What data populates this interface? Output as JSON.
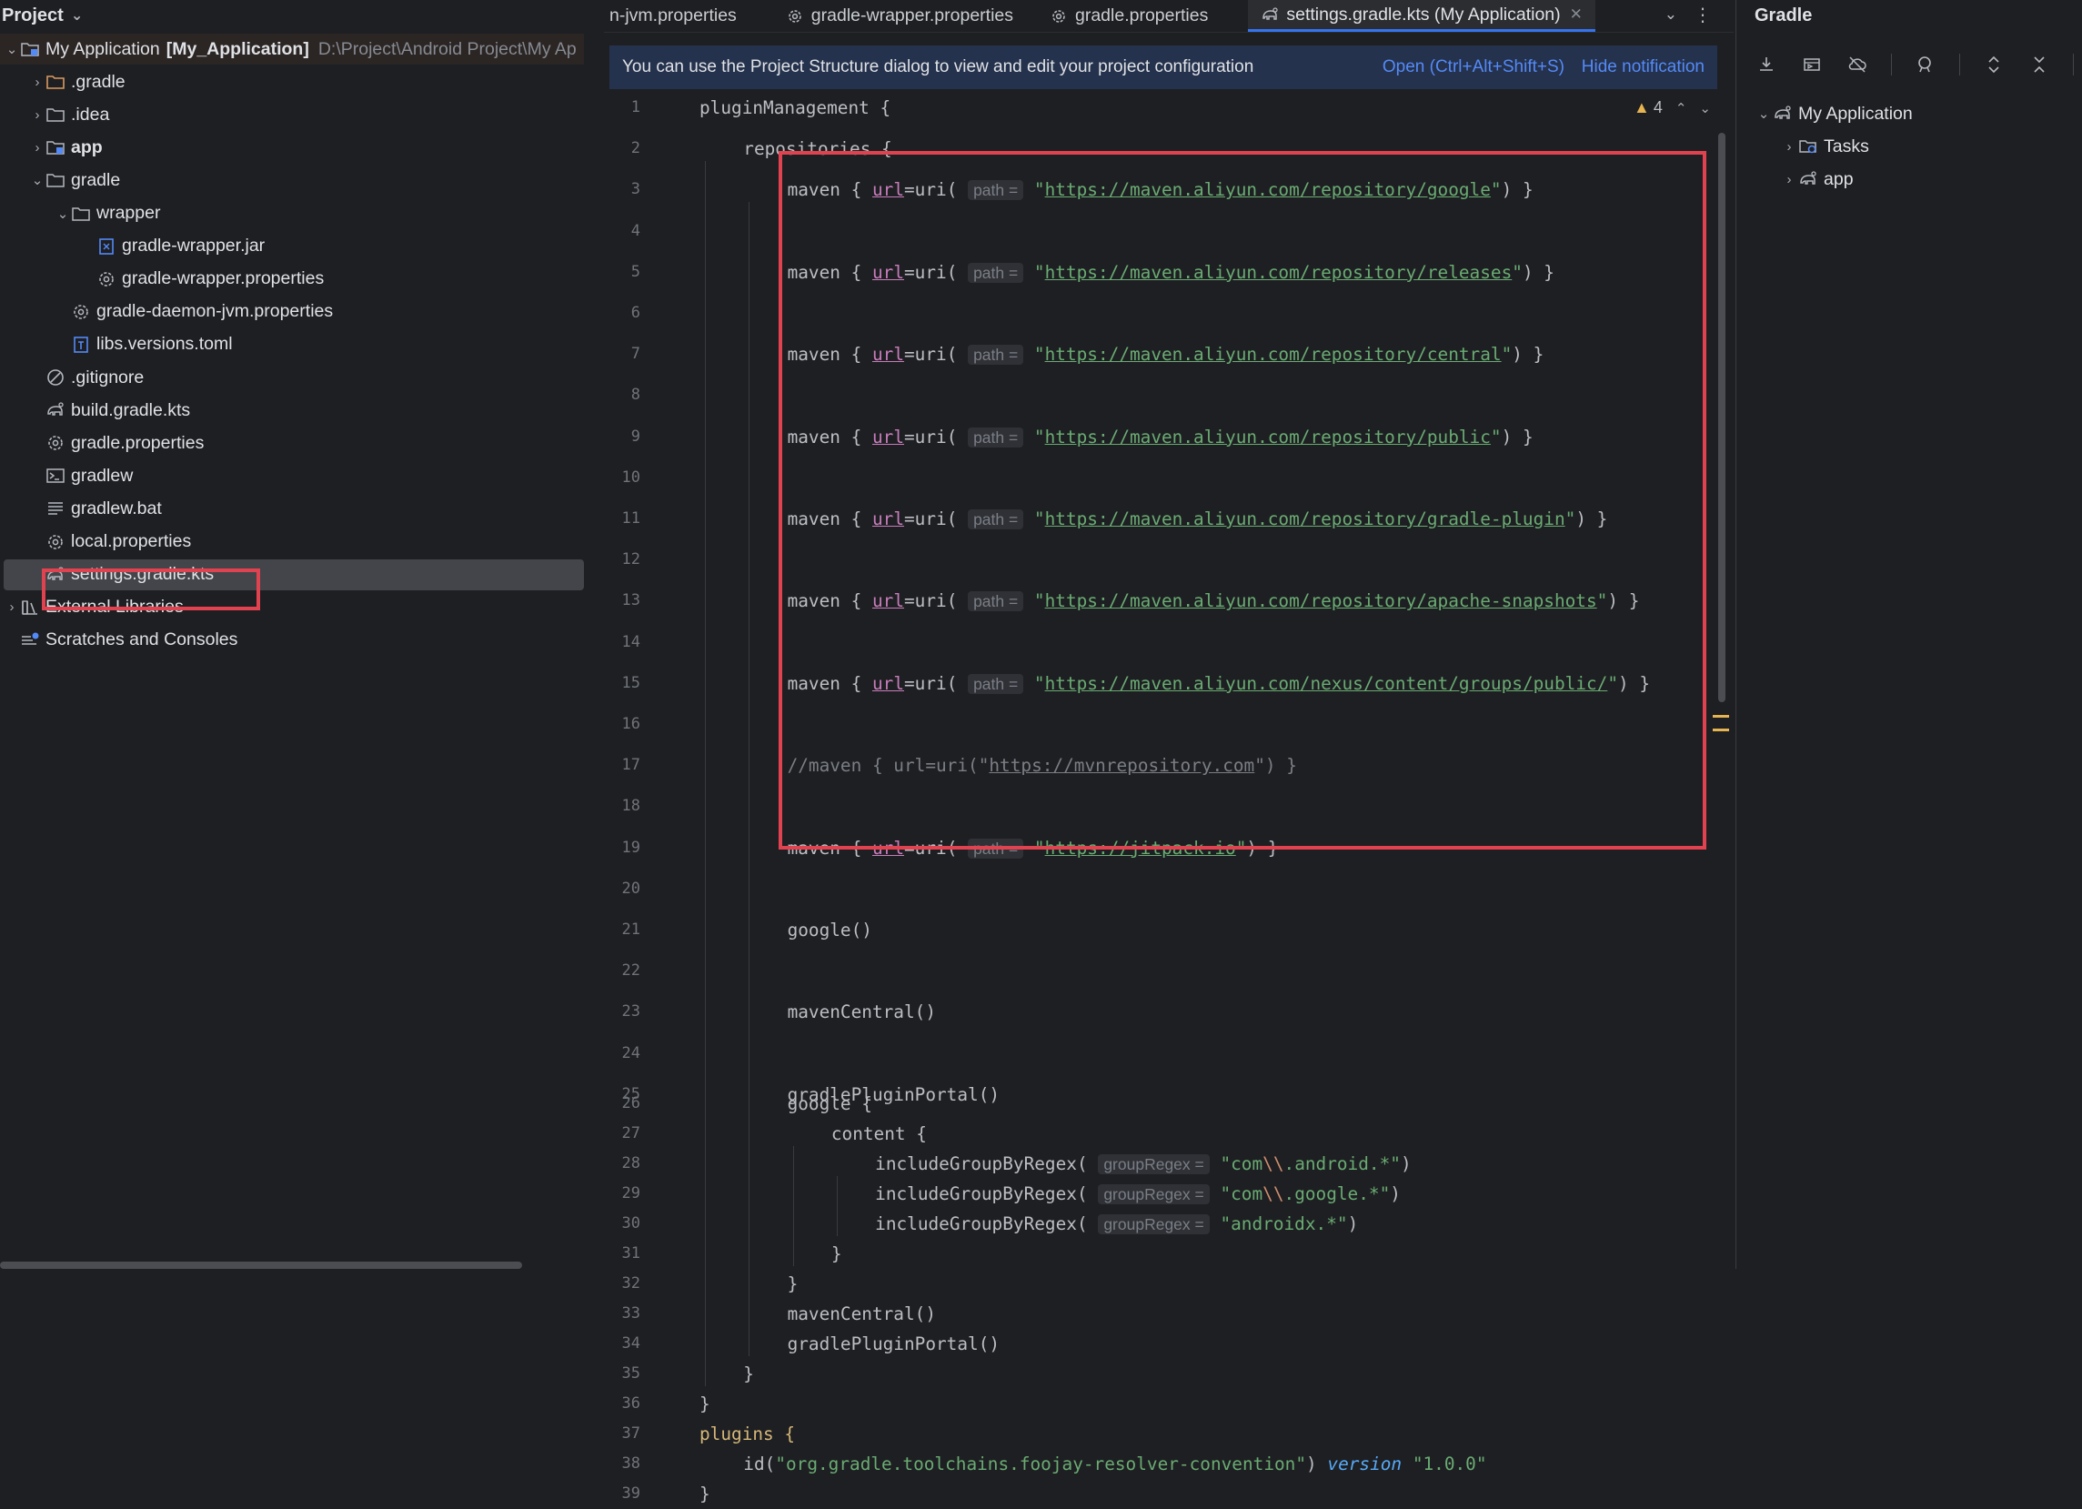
{
  "project_panel": {
    "title": "Project",
    "tree": [
      {
        "label": "My Application",
        "bold_suffix": "[My_Application]",
        "path": "D:\\Project\\Android Project\\My Ap",
        "icon": "module-folder-icon"
      },
      {
        "label": ".gradle",
        "icon": "folder-icon"
      },
      {
        "label": ".idea",
        "icon": "folder-icon"
      },
      {
        "label": "app",
        "icon": "module-folder-icon"
      },
      {
        "label": "gradle",
        "icon": "folder-icon"
      },
      {
        "label": "wrapper",
        "icon": "folder-icon"
      },
      {
        "label": "gradle-wrapper.jar",
        "icon": "jar-icon"
      },
      {
        "label": "gradle-wrapper.properties",
        "icon": "gear-icon"
      },
      {
        "label": "gradle-daemon-jvm.properties",
        "icon": "gear-icon"
      },
      {
        "label": "libs.versions.toml",
        "icon": "toml-icon"
      },
      {
        "label": ".gitignore",
        "icon": "ignore-icon"
      },
      {
        "label": "build.gradle.kts",
        "icon": "gradle-elephant-icon"
      },
      {
        "label": "gradle.properties",
        "icon": "gear-icon"
      },
      {
        "label": "gradlew",
        "icon": "terminal-icon"
      },
      {
        "label": "gradlew.bat",
        "icon": "text-lines-icon"
      },
      {
        "label": "local.properties",
        "icon": "gear-icon"
      },
      {
        "label": "settings.gradle.kts",
        "icon": "gradle-elephant-icon"
      },
      {
        "label": "External Libraries",
        "icon": "library-icon"
      },
      {
        "label": "Scratches and Consoles",
        "icon": "scratches-icon"
      }
    ]
  },
  "editor": {
    "tabs": [
      {
        "label": "n-jvm.properties",
        "icon": "gear-icon"
      },
      {
        "label": "gradle-wrapper.properties",
        "icon": "gear-icon"
      },
      {
        "label": "gradle.properties",
        "icon": "gear-icon"
      },
      {
        "label": "settings.gradle.kts (My Application)",
        "icon": "gradle-elephant-icon"
      }
    ],
    "notification": {
      "text": "You can use the Project Structure dialog to view and edit your project configuration",
      "open_link": "Open (Ctrl+Alt+Shift+S)",
      "hide_link": "Hide notification"
    },
    "warnings_count": "4",
    "hints": {
      "path": "path =",
      "group_regex": "groupRegex ="
    },
    "code": {
      "l1": "pluginManagement {",
      "l2": "repositories {",
      "maven_prefix": "maven { ",
      "url_param": "url",
      "uri_call": "=uri(",
      "urls": [
        "https://maven.aliyun.com/repository/google",
        "https://maven.aliyun.com/repository/releases",
        "https://maven.aliyun.com/repository/central",
        "https://maven.aliyun.com/repository/public",
        "https://maven.aliyun.com/repository/gradle-plugin",
        "https://maven.aliyun.com/repository/apache-snapshots",
        "https://maven.aliyun.com/nexus/content/groups/public/",
        "https://jitpack.io"
      ],
      "comment_prefix": "//maven { url=uri(\"",
      "comment_url": "https://mvnrepository.com",
      "comment_suffix": "\") }",
      "l21": "google()",
      "l23": "mavenCentral()",
      "l25": "gradlePluginPortal()",
      "l26": "google {",
      "l27": "content {",
      "include_fn": "includeGroupByRegex(",
      "regex1_a": "com",
      "regex1_b": ".android.*",
      "regex2_a": "com",
      "regex2_b": ".google.*",
      "regex3": "androidx.*",
      "esc": "\\\\",
      "l33": "mavenCentral()",
      "l34": "gradlePluginPortal()",
      "close": "}",
      "l37": "plugins {",
      "l38_id": "id(",
      "l38_plugin": "\"org.gradle.toolchains.foojay-resolver-convention\"",
      "l38_version_kw": "version",
      "l38_version": "\"1.0.0\""
    }
  },
  "gradle_panel": {
    "title": "Gradle",
    "tree": [
      {
        "label": "My Application",
        "icon": "gradle-elephant-icon"
      },
      {
        "label": "Tasks",
        "icon": "tasks-folder-icon"
      },
      {
        "label": "app",
        "icon": "gradle-elephant-icon"
      }
    ],
    "toolbar_icons": [
      "download-icon",
      "run-config-icon",
      "offline-icon",
      "analyze-icon",
      "expand-all-icon",
      "collapse-all-icon",
      "settings-gear-icon"
    ]
  }
}
